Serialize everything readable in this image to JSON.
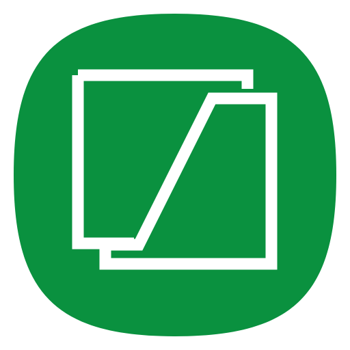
{
  "icon": {
    "name": "split-squares-app-icon",
    "background_color": "#0a913f",
    "glyph_color": "#ffffff",
    "page_background": "#ffffff"
  }
}
